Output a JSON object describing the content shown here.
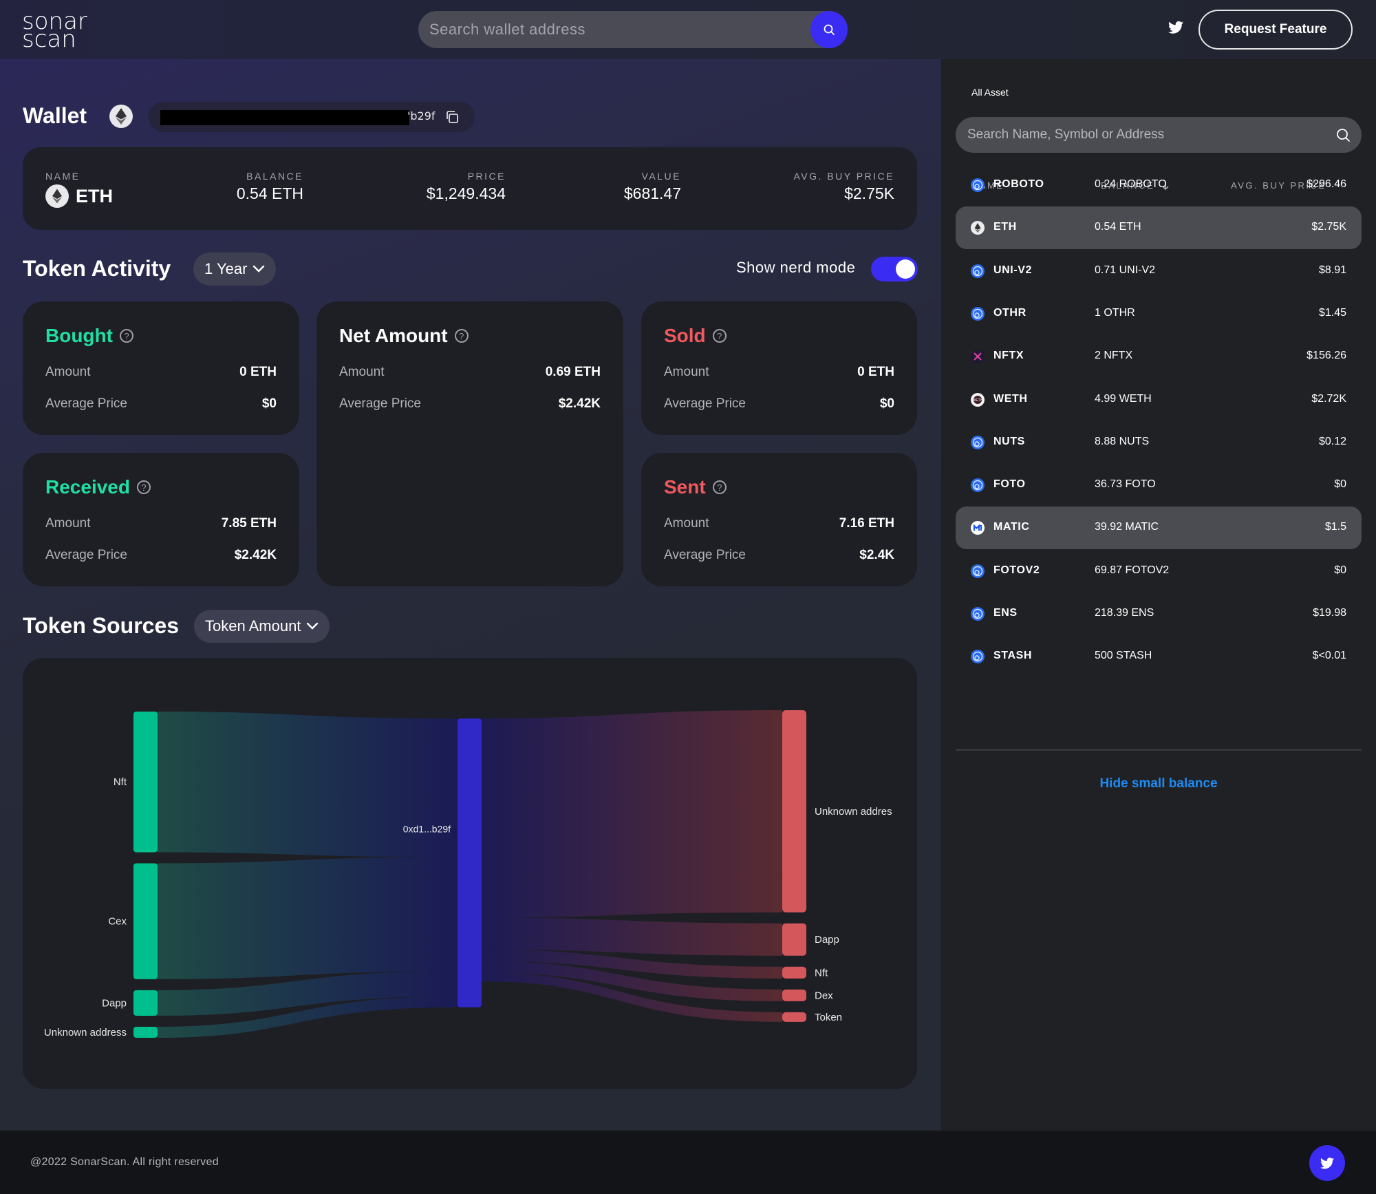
{
  "header": {
    "logo_line1": "sonar",
    "logo_line2": "scan",
    "search_placeholder": "Search wallet address",
    "request_feature": "Request Feature"
  },
  "wallet": {
    "title": "Wallet",
    "address_tail": "'b29f",
    "summary": {
      "name_label": "NAME",
      "name_value": "ETH",
      "balance_label": "BALANCE",
      "balance_value": "0.54 ETH",
      "price_label": "PRICE",
      "price_value": "$1,249.434",
      "value_label": "VALUE",
      "value_value": "$681.47",
      "avg_label": "AVG. BUY PRICE",
      "avg_value": "$2.75K"
    }
  },
  "token_activity": {
    "title": "Token Activity",
    "period": "1 Year",
    "nerd_mode_label": "Show nerd mode",
    "nerd_mode_on": true,
    "cards": {
      "bought": {
        "title": "Bought",
        "amount_label": "Amount",
        "amount": "0 ETH",
        "price_label": "Average Price",
        "price": "$0"
      },
      "net": {
        "title": "Net Amount",
        "amount_label": "Amount",
        "amount": "0.69 ETH",
        "price_label": "Average Price",
        "price": "$2.42K"
      },
      "sold": {
        "title": "Sold",
        "amount_label": "Amount",
        "amount": "0 ETH",
        "price_label": "Average Price",
        "price": "$0"
      },
      "received": {
        "title": "Received",
        "amount_label": "Amount",
        "amount": "7.85 ETH",
        "price_label": "Average Price",
        "price": "$2.42K"
      },
      "sent": {
        "title": "Sent",
        "amount_label": "Amount",
        "amount": "7.16 ETH",
        "price_label": "Average Price",
        "price": "$2.4K"
      }
    }
  },
  "token_sources": {
    "title": "Token Sources",
    "metric": "Token Amount"
  },
  "chart_data": {
    "type": "sankey",
    "title": "Token Sources",
    "colors": {
      "source": "#00bf8f",
      "center": "#3128c8",
      "target": "#d4575c"
    },
    "center_node": "0xd1...b29f",
    "sources": [
      {
        "name": "Nft",
        "value": 204
      },
      {
        "name": "Cex",
        "value": 168
      },
      {
        "name": "Dapp",
        "value": 37
      },
      {
        "name": "Unknown address",
        "value": 16
      }
    ],
    "targets": [
      {
        "name": "Unknown address",
        "value": 293
      },
      {
        "name": "Dapp",
        "value": 47
      },
      {
        "name": "Nft",
        "value": 17
      },
      {
        "name": "Dex",
        "value": 17
      },
      {
        "name": "Token",
        "value": 13
      }
    ]
  },
  "assets": {
    "title": "All Asset",
    "search_placeholder": "Search Name, Symbol or Address",
    "headers": {
      "name": "NAME",
      "balance": "BALANCE",
      "avg": "AVG. BUY PRICE"
    },
    "rows": [
      {
        "name": "ROBOTO",
        "balance": "0.24 ROBOTO",
        "avg": "$296.46",
        "icon": "generic-token",
        "highlight": false
      },
      {
        "name": "ETH",
        "balance": "0.54 ETH",
        "avg": "$2.75K",
        "icon": "eth",
        "highlight": true
      },
      {
        "name": "UNI-V2",
        "balance": "0.71 UNI-V2",
        "avg": "$8.91",
        "icon": "generic-token",
        "highlight": false
      },
      {
        "name": "OTHR",
        "balance": "1 OTHR",
        "avg": "$1.45",
        "icon": "generic-token",
        "highlight": false
      },
      {
        "name": "NFTX",
        "balance": "2 NFTX",
        "avg": "$156.26",
        "icon": "nftx",
        "highlight": false
      },
      {
        "name": "WETH",
        "balance": "4.99 WETH",
        "avg": "$2.72K",
        "icon": "weth",
        "highlight": false
      },
      {
        "name": "NUTS",
        "balance": "8.88 NUTS",
        "avg": "$0.12",
        "icon": "generic-token",
        "highlight": false
      },
      {
        "name": "FOTO",
        "balance": "36.73 FOTO",
        "avg": "$0",
        "icon": "generic-token",
        "highlight": false
      },
      {
        "name": "MATIC",
        "balance": "39.92 MATIC",
        "avg": "$1.5",
        "icon": "matic",
        "highlight": true
      },
      {
        "name": "FOTOV2",
        "balance": "69.87 FOTOV2",
        "avg": "$0",
        "icon": "generic-token",
        "highlight": false
      },
      {
        "name": "ENS",
        "balance": "218.39 ENS",
        "avg": "$19.98",
        "icon": "generic-token",
        "highlight": false
      },
      {
        "name": "STASH",
        "balance": "500 STASH",
        "avg": "$<0.01",
        "icon": "generic-token",
        "highlight": false
      }
    ],
    "hide_small": "Hide small balance"
  },
  "footer": {
    "copyright": "@2022 SonarScan. All right reserved"
  }
}
